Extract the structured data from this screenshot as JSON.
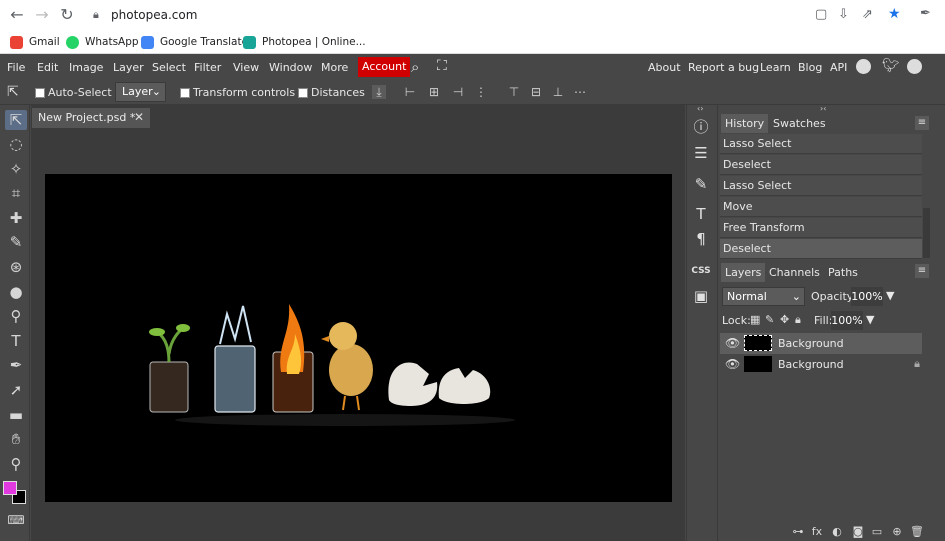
{
  "browser": {
    "url": "photopea.com",
    "bookmarks": [
      {
        "label": "Gmail",
        "color": "#ea4335"
      },
      {
        "label": "WhatsApp",
        "color": "#25d366"
      },
      {
        "label": "Google Translate",
        "color": "#4285f4"
      },
      {
        "label": "Photopea | Online...",
        "color": "#18a497"
      }
    ]
  },
  "menu": {
    "items": [
      "File",
      "Edit",
      "Image",
      "Layer",
      "Select",
      "Filter",
      "View",
      "Window",
      "More"
    ],
    "account": "Account",
    "right": [
      "About",
      "Report a bug",
      "Learn",
      "Blog",
      "API"
    ]
  },
  "options": {
    "auto_select": "Auto-Select",
    "layer_value": "Layer",
    "transform_controls": "Transform controls",
    "distances": "Distances"
  },
  "document": {
    "tab_title": "New Project.psd *"
  },
  "history": {
    "tabs": [
      "History",
      "Swatches"
    ],
    "items": [
      "Lasso Select",
      "Deselect",
      "Lasso Select",
      "Move",
      "Free Transform",
      "Deselect"
    ]
  },
  "layers_panel": {
    "tabs": [
      "Layers",
      "Channels",
      "Paths"
    ],
    "blend_mode": "Normal",
    "opacity_label": "Opacity:",
    "opacity_value": "100%",
    "lock_label": "Lock:",
    "fill_label": "Fill:",
    "fill_value": "100%",
    "layers": [
      {
        "name": "Background",
        "selected": true,
        "locked": false
      },
      {
        "name": "Background",
        "selected": false,
        "locked": true
      }
    ]
  },
  "side_icons": [
    "info-icon",
    "adjust-icon",
    "brush-settings-icon",
    "character-icon",
    "paragraph-icon",
    "css-icon",
    "image-icon"
  ],
  "colors": {
    "foreground": "#e03ae0",
    "background": "#000000",
    "accent": "#d10000"
  }
}
